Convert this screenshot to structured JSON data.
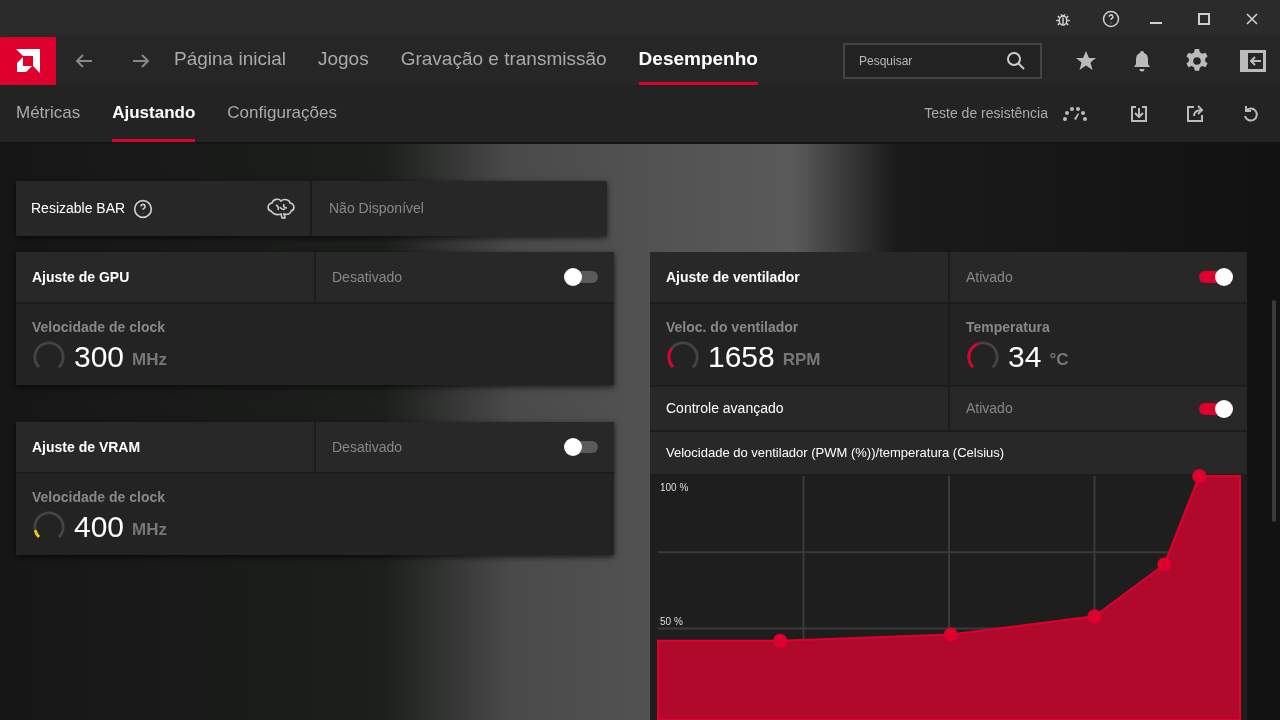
{
  "main_tabs": [
    {
      "label": "Página inicial",
      "selected": false
    },
    {
      "label": "Jogos",
      "selected": false
    },
    {
      "label": "Gravação e transmissão",
      "selected": false
    },
    {
      "label": "Desempenho",
      "selected": true
    }
  ],
  "search": {
    "placeholder": "Pesquisar"
  },
  "sub_tabs": [
    {
      "label": "Métricas",
      "selected": false
    },
    {
      "label": "Ajustando",
      "selected": true
    },
    {
      "label": "Configurações",
      "selected": false
    }
  ],
  "stress_test": {
    "label": "Teste de resistência"
  },
  "resizable_bar": {
    "label": "Resizable BAR",
    "value": "Não Disponível"
  },
  "gpu_tuning": {
    "title": "Ajuste de GPU",
    "state_label": "Desativado",
    "on": false,
    "metric": {
      "label": "Velocidade de clock",
      "value": "300",
      "unit": "MHz"
    }
  },
  "vram_tuning": {
    "title": "Ajuste de VRAM",
    "state_label": "Desativado",
    "on": false,
    "metric": {
      "label": "Velocidade de clock",
      "value": "400",
      "unit": "MHz",
      "level": 0.12,
      "color": "#f5c518"
    }
  },
  "fan_tuning": {
    "title": "Ajuste de ventilador",
    "state_label": "Ativado",
    "on": true,
    "metrics": [
      {
        "label": "Veloc. do ventilador",
        "value": "1658",
        "unit": "RPM",
        "level": 0.3,
        "color": "#e0002e"
      },
      {
        "label": "Temperatura",
        "value": "34",
        "unit": "°C",
        "level": 0.42,
        "color": "#e0002e"
      }
    ],
    "advanced": {
      "label": "Controle avançado",
      "state_label": "Ativado",
      "on": true
    },
    "chart_title": "Velocidade do ventilador (PWM (%))/temperatura (Celsius)",
    "chart_axis_labels": [
      "100 %",
      "50 %"
    ]
  }
}
